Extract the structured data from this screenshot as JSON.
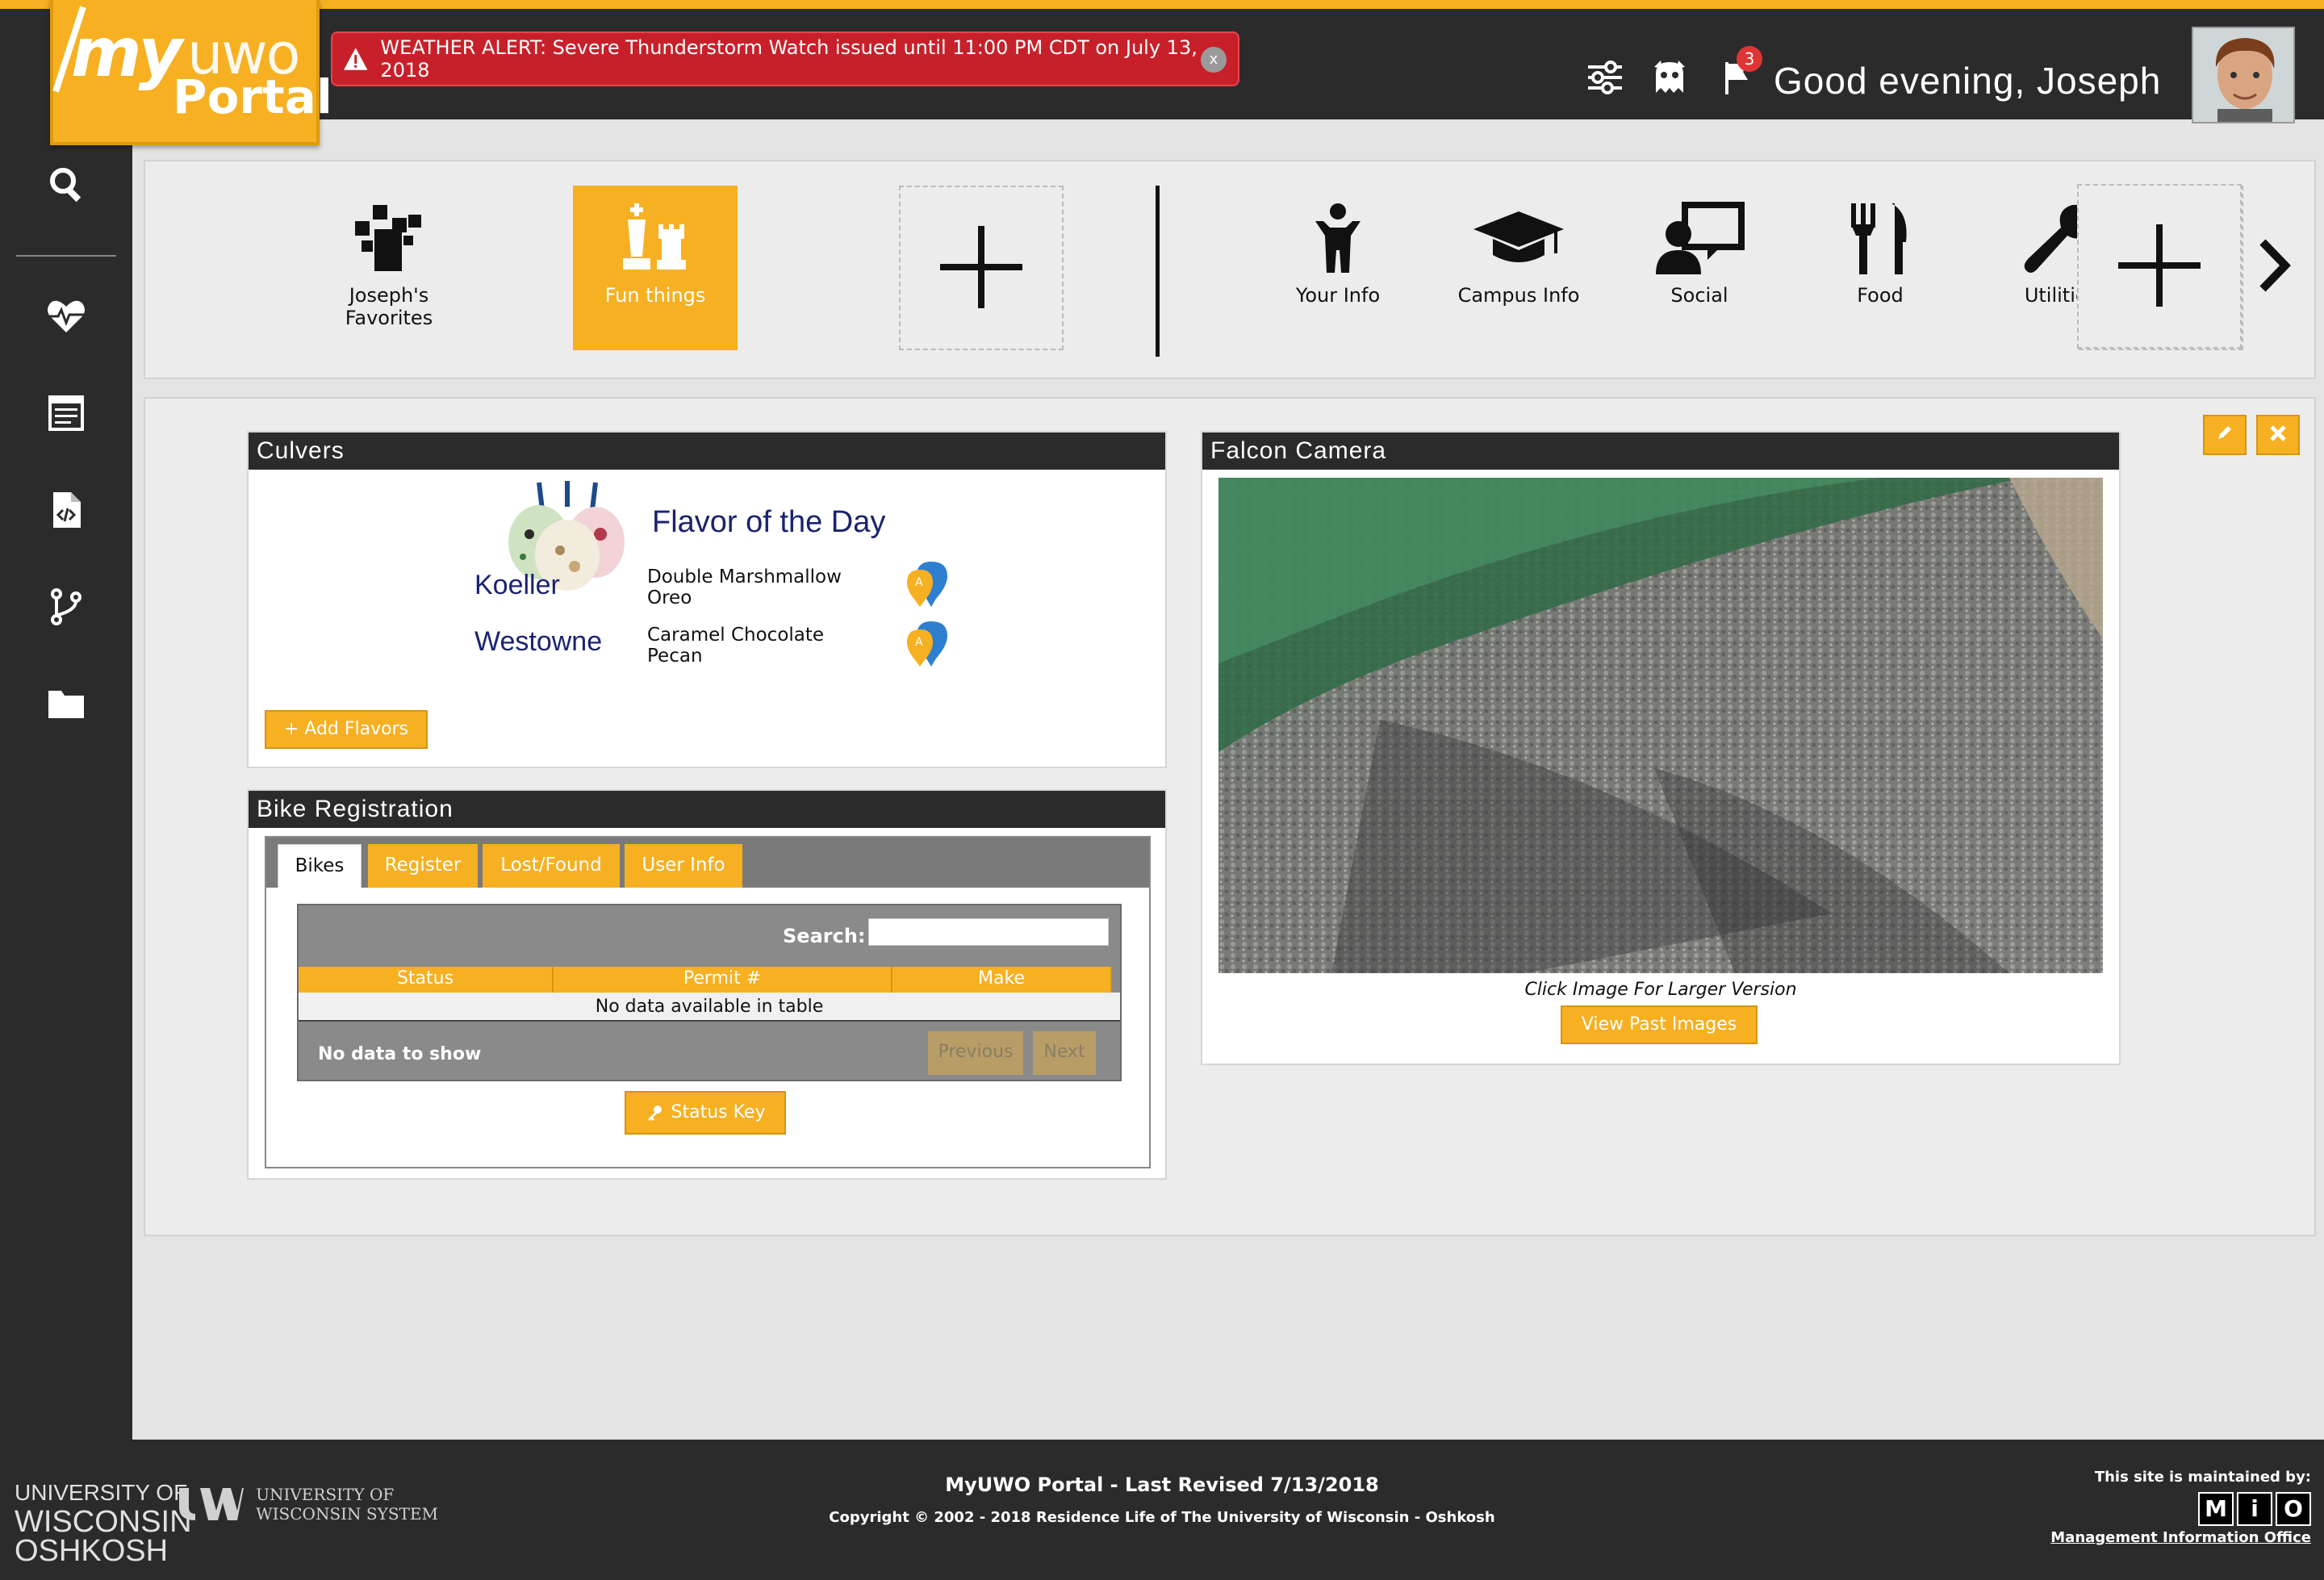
{
  "logo": {
    "my": "my",
    "uwo": "uwo",
    "portal": "Portal"
  },
  "alert": {
    "text": "WEATHER ALERT: Severe Thunderstorm Watch issued until 11:00 PM CDT on July 13, 2018",
    "close": "x"
  },
  "header": {
    "greeting": "Good evening, Joseph",
    "notification_count": "3"
  },
  "shortcuts": {
    "favorites": "Joseph's Favorites",
    "fun_things": "Fun things",
    "your_info": "Your Info",
    "campus_info": "Campus Info",
    "social": "Social",
    "food": "Food",
    "utilities": "Utilities"
  },
  "culvers": {
    "title": "Culvers",
    "flavor_heading": "Flavor of the Day",
    "locations": [
      {
        "name": "Koeller",
        "flavor_line1": "Double Marshmallow",
        "flavor_line2": "Oreo"
      },
      {
        "name": "Westowne",
        "flavor_line1": "Caramel Chocolate",
        "flavor_line2": "Pecan"
      }
    ],
    "add_button": "+ Add Flavors"
  },
  "bike": {
    "title": "Bike Registration",
    "tabs": [
      "Bikes",
      "Register",
      "Lost/Found",
      "User Info"
    ],
    "search_label": "Search:",
    "columns": [
      "Status",
      "Permit #",
      "Make"
    ],
    "empty_text": "No data available in table",
    "info_text": "No data to show",
    "prev": "Previous",
    "next": "Next",
    "status_key": "Status Key"
  },
  "falcon": {
    "title": "Falcon Camera",
    "caption": "Click Image For Larger Version",
    "past_button": "View Past Images"
  },
  "footer": {
    "title": "MyUWO Portal - Last Revised 7/13/2018",
    "copyright": "Copyright © 2002 - 2018 Residence Life of The University of Wisconsin - Oshkosh",
    "uwo_line1": "UNIVERSITY OF",
    "uwo_line2": "WISCONSIN",
    "uwo_line3": "OSHKOSH",
    "uwsys_line1": "UNIVERSITY OF",
    "uwsys_line2": "WISCONSIN SYSTEM",
    "maintained": "This site is maintained by:",
    "mio": [
      "M",
      "i",
      "O"
    ],
    "mio_link": "Management Information Office"
  },
  "colors": {
    "accent": "#f6b022",
    "dark": "#2b2b2b",
    "alert": "#c8202a",
    "navy": "#1a2370"
  }
}
